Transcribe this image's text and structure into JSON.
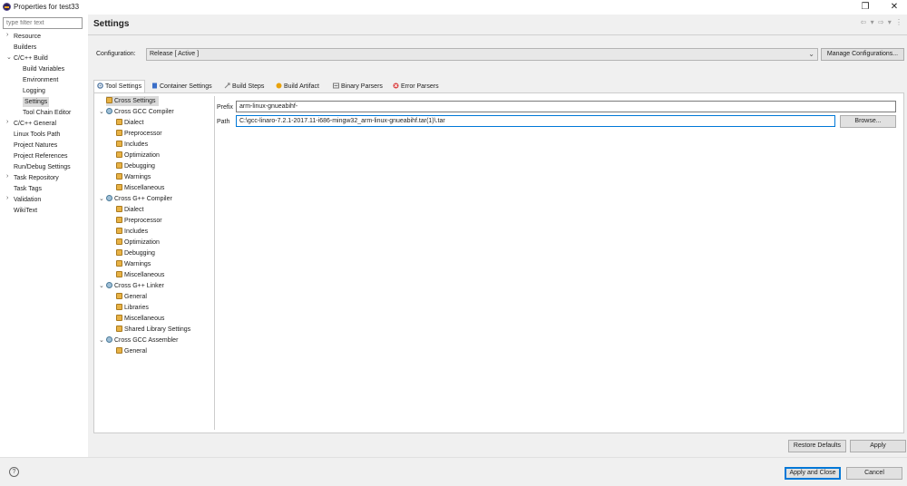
{
  "window": {
    "title": "Properties for test33",
    "restore_glyph": "❐",
    "close_glyph": "✕"
  },
  "filter": {
    "placeholder": "type filter text"
  },
  "nav": {
    "items": [
      {
        "label": "Resource",
        "caret": "›"
      },
      {
        "label": "Builders",
        "caret": ""
      },
      {
        "label": "C/C++ Build",
        "caret": "⌄"
      },
      {
        "label": "Build Variables",
        "caret": ""
      },
      {
        "label": "Environment",
        "caret": ""
      },
      {
        "label": "Logging",
        "caret": ""
      },
      {
        "label": "Settings",
        "caret": "",
        "selected": true
      },
      {
        "label": "Tool Chain Editor",
        "caret": ""
      },
      {
        "label": "C/C++ General",
        "caret": "›"
      },
      {
        "label": "Linux Tools Path",
        "caret": ""
      },
      {
        "label": "Project Natures",
        "caret": ""
      },
      {
        "label": "Project References",
        "caret": ""
      },
      {
        "label": "Run/Debug Settings",
        "caret": ""
      },
      {
        "label": "Task Repository",
        "caret": "›"
      },
      {
        "label": "Task Tags",
        "caret": ""
      },
      {
        "label": "Validation",
        "caret": "›"
      },
      {
        "label": "WikiText",
        "caret": ""
      }
    ]
  },
  "header": {
    "title": "Settings",
    "nav_glyphs": "⇦ ▾ ⇨ ▾ ⋮"
  },
  "configuration": {
    "label": "Configuration:",
    "value": "Release  [ Active ]",
    "manage_label": "Manage Configurations..."
  },
  "tabs": [
    {
      "label": "Tool Settings",
      "icon": "gear-icon",
      "color": "#5a7fa8"
    },
    {
      "label": "Container Settings",
      "icon": "container-icon",
      "color": "#3a6ec8"
    },
    {
      "label": "Build Steps",
      "icon": "build-steps-icon",
      "color": "#8a8a8a"
    },
    {
      "label": "Build Artifact",
      "icon": "artifact-icon",
      "color": "#e8a20c"
    },
    {
      "label": "Binary Parsers",
      "icon": "binary-parsers-icon",
      "color": "#7a7a7a"
    },
    {
      "label": "Error Parsers",
      "icon": "error-parsers-icon",
      "color": "#d83a3a"
    }
  ],
  "tree": {
    "rows": [
      {
        "label": "Cross Settings",
        "level": 0,
        "type": "leaf",
        "selected": true
      },
      {
        "label": "Cross GCC Compiler",
        "level": 0,
        "type": "node",
        "expanded": true
      },
      {
        "label": "Dialect",
        "level": 1,
        "type": "leaf"
      },
      {
        "label": "Preprocessor",
        "level": 1,
        "type": "leaf"
      },
      {
        "label": "Includes",
        "level": 1,
        "type": "leaf"
      },
      {
        "label": "Optimization",
        "level": 1,
        "type": "leaf"
      },
      {
        "label": "Debugging",
        "level": 1,
        "type": "leaf"
      },
      {
        "label": "Warnings",
        "level": 1,
        "type": "leaf"
      },
      {
        "label": "Miscellaneous",
        "level": 1,
        "type": "leaf"
      },
      {
        "label": "Cross G++ Compiler",
        "level": 0,
        "type": "node",
        "expanded": true
      },
      {
        "label": "Dialect",
        "level": 1,
        "type": "leaf"
      },
      {
        "label": "Preprocessor",
        "level": 1,
        "type": "leaf"
      },
      {
        "label": "Includes",
        "level": 1,
        "type": "leaf"
      },
      {
        "label": "Optimization",
        "level": 1,
        "type": "leaf"
      },
      {
        "label": "Debugging",
        "level": 1,
        "type": "leaf"
      },
      {
        "label": "Warnings",
        "level": 1,
        "type": "leaf"
      },
      {
        "label": "Miscellaneous",
        "level": 1,
        "type": "leaf"
      },
      {
        "label": "Cross G++ Linker",
        "level": 0,
        "type": "node",
        "expanded": true
      },
      {
        "label": "General",
        "level": 1,
        "type": "leaf"
      },
      {
        "label": "Libraries",
        "level": 1,
        "type": "leaf"
      },
      {
        "label": "Miscellaneous",
        "level": 1,
        "type": "leaf"
      },
      {
        "label": "Shared Library Settings",
        "level": 1,
        "type": "leaf"
      },
      {
        "label": "Cross GCC Assembler",
        "level": 0,
        "type": "node",
        "expanded": true
      },
      {
        "label": "General",
        "level": 1,
        "type": "leaf"
      }
    ]
  },
  "form": {
    "prefix_label": "Prefix",
    "prefix_value": "arm-linux-gnueabihf-",
    "path_label": "Path",
    "path_value": "C:\\gcc-linaro-7.2.1-2017.11-i686-mingw32_arm-linux-gnueabihf.tar(1)\\.tar",
    "browse_label": "Browse..."
  },
  "footer": {
    "restore_label": "Restore Defaults",
    "apply_label": "Apply",
    "apply_close_label": "Apply and Close",
    "cancel_label": "Cancel",
    "help_glyph": "?"
  }
}
